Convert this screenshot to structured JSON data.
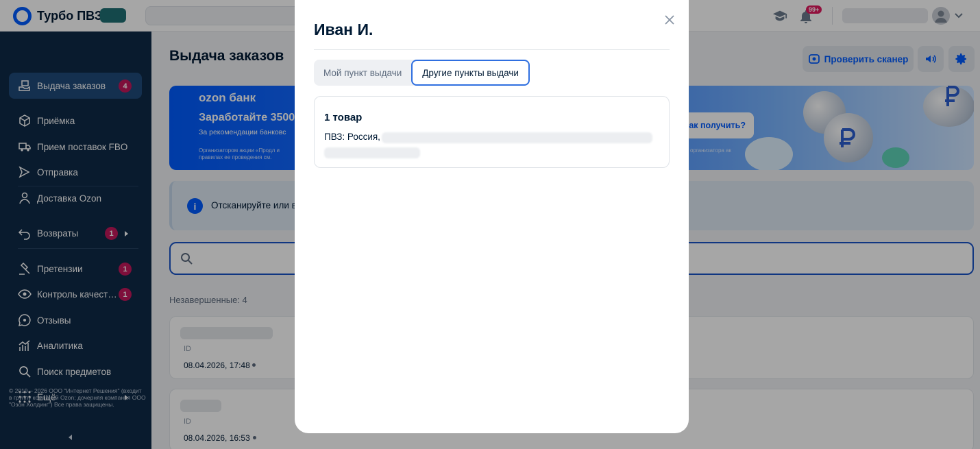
{
  "app": {
    "title": "Турбо ПВЗ"
  },
  "topbar": {
    "notifications_badge": "99+"
  },
  "sidebar": {
    "items": [
      {
        "label": "Выдача заказов",
        "badge": "4"
      },
      {
        "label": "Приёмка"
      },
      {
        "label": "Прием поставок FBO"
      },
      {
        "label": "Отправка"
      },
      {
        "label": "Доставка Ozon"
      },
      {
        "label": "Возвраты",
        "badge": "1"
      },
      {
        "label": "Претензии",
        "badge": "1"
      },
      {
        "label": "Контроль качест…",
        "badge": "1"
      },
      {
        "label": "Отзывы"
      },
      {
        "label": "Аналитика"
      },
      {
        "label": "Поиск предметов"
      },
      {
        "label": "Ещё"
      }
    ],
    "copyright": "© 2019 – 2026 ООО \"Интернет Решения\" (входит в группу компаний Ozon; дочерняя компания ООО \"Озон Холдинг\") Все права защищены."
  },
  "main": {
    "title": "Выдача заказов",
    "check_scanner": "Проверить сканер",
    "banner": {
      "brand": "ozon банк",
      "headline": "Заработайте 3500",
      "subline": "За рекомендации банковс",
      "fine": "Организатором акции «Продл и правилах ее проведения см.",
      "cta": "ак получить?",
      "fine_right": "организатора ак"
    },
    "info_text": "Отсканируйте или в",
    "list_label": "Незавершенные: 4",
    "orders": [
      {
        "id_label": "ID",
        "date": "08.04.2026, 17:48"
      },
      {
        "id_label": "ID",
        "date": "08.04.2026, 16:53"
      }
    ]
  },
  "modal": {
    "title": "Иван И.",
    "tabs": [
      {
        "label": "Мой пункт выдачи",
        "active": false
      },
      {
        "label": "Другие пункты выдачи",
        "active": true
      }
    ],
    "card": {
      "count": "1 товар",
      "pvz_label": "ПВЗ: Россия,"
    }
  },
  "colors": {
    "brand": "#005bff",
    "sidebar": "#0f2a47",
    "badge": "#c2185b"
  }
}
